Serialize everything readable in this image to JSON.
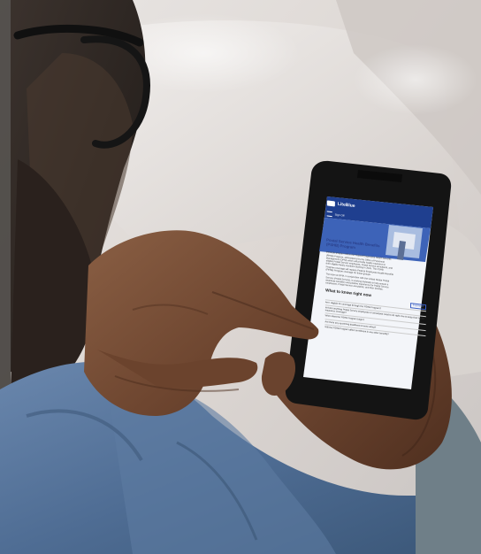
{
  "phone": {
    "app_name": "LiteBlue",
    "sign_in": "Sign Off",
    "hero_title_line1": "Postal Service Health Benefits",
    "hero_title_line2": "(PSHB) Program",
    "intro": [
      "The Postal Service Health Benefits (PSHB) Program is a new,",
      "separate program within the Federal Employees Health Benefits",
      "(FEHB) Program, administered by the Office of Personnel",
      "Management (OPM) which will provide health insurance to",
      "eligible Postal Service employees, Postal Service annuitants, and",
      "their eligible family members starting in 2025. The PSHB",
      "Program coverage will replace Federal Employees Health Benefits",
      "(FEHB) Program coverage for these groups."
    ],
    "intro2": [
      "The team at OPM, in conjunction with the United States Postal",
      "Service (Postal Service), is working tirelessly to help ensure a",
      "seamless transition and positive experience for Postal Service",
      "employees, Postal Service annuitants, and their families."
    ],
    "section_heading": "What to know right now",
    "expand_button": "Expand all",
    "faq": [
      "Am I eligible for coverage through the PSHB Program?",
      "Is there anything Postal Service employees or annuitants need to do right now to keep their health insurance coverage?",
      "When does the PSHB Program begin?",
      "Are there any upcoming deadlines to know about?",
      "Will the PSHB Program affect enrollment in any other benefits?"
    ]
  },
  "colors": {
    "app_header": "#1f3f8f",
    "hero_band": "#3d63b8",
    "hero_title": "#2a3f8a",
    "link_text": "#3b5fc4",
    "shirt": "#4f6d94"
  }
}
